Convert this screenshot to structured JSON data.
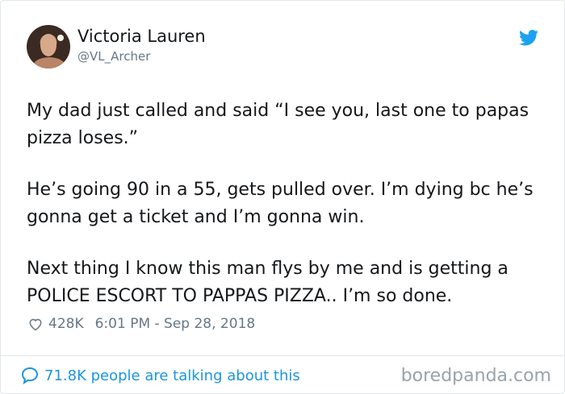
{
  "tweet": {
    "author_name": "Victoria Lauren",
    "author_handle": "@VL_Archer",
    "paragraphs": [
      "My dad just called and said “I see you, last one to papas pizza loses.”",
      "He’s going 90 in a 55, gets pulled over. I’m dying bc he’s gonna get a ticket and I’m gonna win.",
      "Next thing I know this man flys by me and is getting a POLICE ESCORT TO PAPPAS PIZZA.. I’m so done."
    ],
    "likes": "428K",
    "timestamp": "6:01 PM - Sep 28, 2018",
    "conversation": "71.8K people are talking about this"
  },
  "watermark": "boredpanda.com",
  "icons": {
    "platform": "twitter-bird-icon",
    "like": "heart-icon",
    "reply": "speech-bubble-icon"
  },
  "colors": {
    "accent": "#1da1f2",
    "link": "#1b95e0",
    "muted": "#657786",
    "text": "#14171a"
  }
}
